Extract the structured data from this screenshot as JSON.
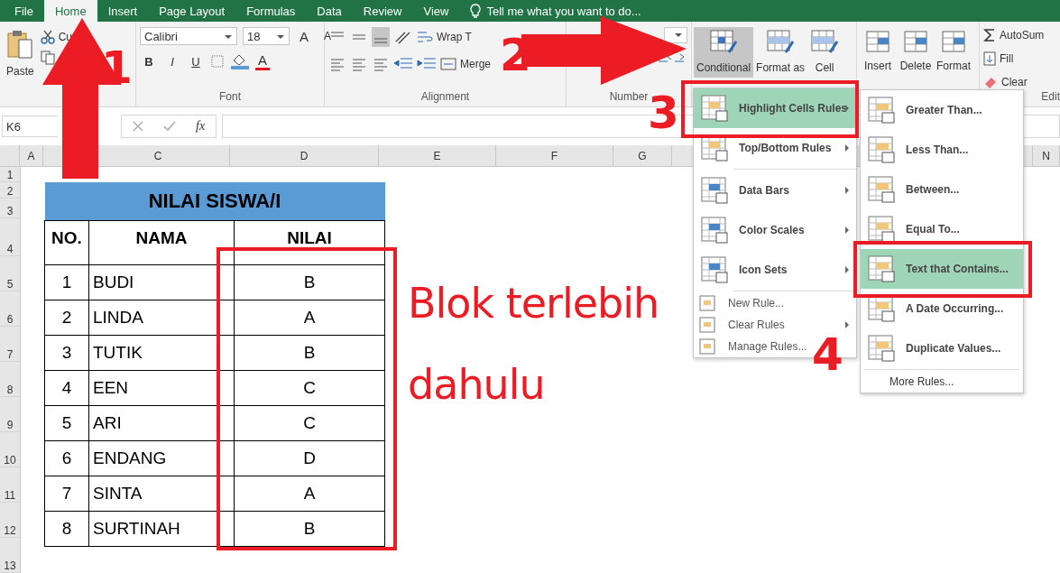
{
  "ribbon_tabs": [
    {
      "label": "File",
      "selected": false
    },
    {
      "label": "Home",
      "selected": true
    },
    {
      "label": "Insert",
      "selected": false
    },
    {
      "label": "Page Layout",
      "selected": false
    },
    {
      "label": "Formulas",
      "selected": false
    },
    {
      "label": "Data",
      "selected": false
    },
    {
      "label": "Review",
      "selected": false
    },
    {
      "label": "View",
      "selected": false
    }
  ],
  "tell_me": "Tell me what you want to do...",
  "clipboard": {
    "paste": "Paste",
    "cut": "Cu"
  },
  "font": {
    "label": "Font",
    "family": "Calibri",
    "size": "18",
    "grow": "A",
    "shrink": "A",
    "bold": "B",
    "italic": "I",
    "underline": "U",
    "color_button": "A"
  },
  "alignment": {
    "label": "Alignment",
    "wrap": "Wrap T",
    "merge": "Merge"
  },
  "number": {
    "label": "Number"
  },
  "styles": [
    {
      "label": "Conditional",
      "selected": true
    },
    {
      "label": "Format as",
      "selected": false
    },
    {
      "label": "Cell",
      "selected": false
    }
  ],
  "cells": [
    "Insert",
    "Delete",
    "Format"
  ],
  "editing": {
    "label": "Edit",
    "autosum": "AutoSum",
    "fill": "Fill",
    "clear": "Clear"
  },
  "name_box": "K6",
  "fx": "fx",
  "column_headers": [
    "A",
    "C",
    "D",
    "E",
    "F",
    "G",
    "N"
  ],
  "row_headers": [
    "1",
    "2",
    "3",
    "4",
    "5",
    "6",
    "7",
    "8",
    "9",
    "10",
    "11",
    "12",
    "13"
  ],
  "table": {
    "title": "NILAI SISWA/I",
    "columns": [
      "NO.",
      "NAMA",
      "NILAI"
    ],
    "rows": [
      [
        "1",
        "BUDI",
        "B"
      ],
      [
        "2",
        "LINDA",
        "A"
      ],
      [
        "3",
        "TUTIK",
        "B"
      ],
      [
        "4",
        "EEN",
        "C"
      ],
      [
        "5",
        "ARI",
        "C"
      ],
      [
        "6",
        "ENDANG",
        "D"
      ],
      [
        "7",
        "SINTA",
        "A"
      ],
      [
        "8",
        "SURTINAH",
        "B"
      ]
    ]
  },
  "cf_menu": [
    [
      {
        "label": "Highlight Cells Rules",
        "selected": true,
        "submenu": true,
        "kind": "large"
      },
      {
        "label": "Top/Bottom Rules",
        "selected": false,
        "submenu": true,
        "kind": "large"
      }
    ],
    [
      {
        "label": "Data Bars",
        "selected": false,
        "submenu": true,
        "kind": "large"
      },
      {
        "label": "Color Scales",
        "selected": false,
        "submenu": true,
        "kind": "large"
      },
      {
        "label": "Icon Sets",
        "selected": false,
        "submenu": true,
        "kind": "large"
      }
    ],
    [
      {
        "label": "New Rule...",
        "selected": false,
        "submenu": false,
        "kind": "small"
      },
      {
        "label": "Clear Rules",
        "selected": false,
        "submenu": true,
        "kind": "small"
      },
      {
        "label": "Manage Rules...",
        "selected": false,
        "submenu": false,
        "kind": "small"
      }
    ]
  ],
  "highlight_menu": [
    [
      {
        "label": "Greater Than...",
        "selected": false,
        "kind": "large"
      },
      {
        "label": "Less Than...",
        "selected": false,
        "kind": "large"
      },
      {
        "label": "Between...",
        "selected": false,
        "kind": "large"
      },
      {
        "label": "Equal To...",
        "selected": false,
        "kind": "large"
      },
      {
        "label": "Text that Contains...",
        "selected": true,
        "kind": "large"
      },
      {
        "label": "A Date Occurring...",
        "selected": false,
        "kind": "large"
      },
      {
        "label": "Duplicate Values...",
        "selected": false,
        "kind": "large"
      }
    ],
    [
      {
        "label": "More Rules...",
        "selected": false,
        "kind": "small"
      }
    ]
  ],
  "annotations": {
    "steps": [
      "1",
      "2",
      "3",
      "4"
    ],
    "note": [
      "Blok terlebih",
      "dahulu"
    ]
  }
}
